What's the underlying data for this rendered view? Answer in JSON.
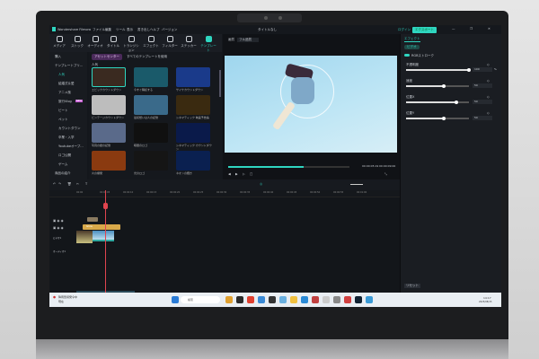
{
  "app": {
    "title": "Wondershare Filmora",
    "menu": [
      "ファイル",
      "編集",
      "ツール",
      "表示",
      "書き出し",
      "ヘルプ",
      "バージョン"
    ],
    "project_title": "タイトルなし",
    "login_label": "ログイン",
    "export_label": "エクスポート"
  },
  "toolbar": {
    "items": [
      "メディア",
      "ストック",
      "オーディオ",
      "タイトル",
      "トランジション",
      "エフェクト",
      "フィルター",
      "ステッカー",
      "テンプレート"
    ],
    "active": "テンプレート"
  },
  "sidebar": {
    "items": [
      "購入",
      "テンプレートプリ…",
      "人気",
      "結婚式＆愛",
      "アニメ風",
      "旅行Vlog",
      "ビート",
      "ペット",
      "カウントダウン",
      "卒業・入学",
      "Youtubeオープ…",
      "ロゴ公開",
      "ゲーム",
      "商品の紹介"
    ],
    "badge": "NEW"
  },
  "templates": {
    "asset_center": "アセットセンター",
    "filter_label": "すべてのテンプレートを使用",
    "section": "人気",
    "items": [
      "エピックカウントダウン",
      "今すぐ購読する",
      "サイケカウントダウン",
      "ビンテージカウントダウン",
      "最初想いは人の記憶",
      "シネマティック 映画予告編",
      "写真の壁の記憶",
      "暗闇のロゴ",
      "シネマティック カウントダウン",
      "炎の爆発",
      "光のロゴ",
      "ネオンの輝き"
    ]
  },
  "preview": {
    "quality_label": "画質",
    "quality_value": "フル品質",
    "current_time": "00:00:05:19",
    "total_time": "00:00:09:00",
    "progress": 0.62
  },
  "effects_panel": {
    "tab": "エフェクト",
    "subtab": "ビデオ",
    "effect_name": "RGBストローク",
    "params": [
      {
        "label": "不透明度",
        "value": "100",
        "unit": "%",
        "level": 1.0
      },
      {
        "label": "速度",
        "value": "50",
        "level": 0.6
      },
      {
        "label": "位置X",
        "value": "50",
        "level": 0.8
      },
      {
        "label": "位置Y",
        "value": "50",
        "level": 0.6
      }
    ],
    "reset_label": "リセット"
  },
  "timeline": {
    "ruler": [
      "00:00",
      "00:00:05",
      "00:00:10",
      "00:00:15",
      "00:00:20",
      "00:00:25",
      "00:00:30",
      "00:00:35",
      "00:00:40",
      "00:00:45",
      "00:00:50",
      "00:00:55",
      "00:01:00"
    ],
    "title_clip": "Glow",
    "track_labels": [
      "ビデオ1",
      "オーディオ1"
    ]
  },
  "taskbar": {
    "weather": "降雨警報発令中",
    "weather_sub": "現在",
    "search_placeholder": "検索",
    "time": "14:17",
    "date": "2025/08/15"
  },
  "colors": {
    "accent": "#2fd6c0",
    "playhead": "#e0454f",
    "clip_title": "#d9a94a"
  }
}
